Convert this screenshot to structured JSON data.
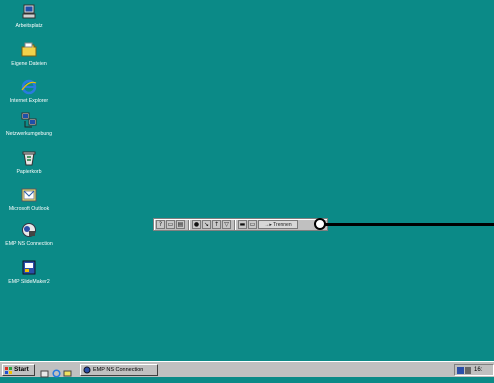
{
  "desktop": {
    "icons": [
      {
        "label": "Arbeitsplatz",
        "icon": "my-computer-icon"
      },
      {
        "label": "Eigene Dateien",
        "icon": "folder-icon"
      },
      {
        "label": "Internet Explorer",
        "icon": "internet-explorer-icon"
      },
      {
        "label": "Netzwerkumgebung",
        "icon": "network-icon"
      },
      {
        "label": "Papierkorb",
        "icon": "recycle-bin-icon"
      },
      {
        "label": "Microsoft Outlook",
        "icon": "outlook-icon"
      },
      {
        "label": "EMP NS Connection",
        "icon": "emp-ns-connection-icon"
      },
      {
        "label": "EMP SlideMaker2",
        "icon": "emp-slidemaker-icon"
      }
    ],
    "background_color": "#0b8a87"
  },
  "toolbar": {
    "disconnect_label": "→▸ Trennen",
    "buttons": [
      "help-icon",
      "display-icon",
      "document-icon",
      "info-icon",
      "mute-icon",
      "pointer-icon",
      "freeze-icon",
      "screen-icon",
      "volume-icon"
    ]
  },
  "taskbar": {
    "start_label": "Start",
    "task_label": "EMP NS Connection",
    "clock": "16:"
  }
}
